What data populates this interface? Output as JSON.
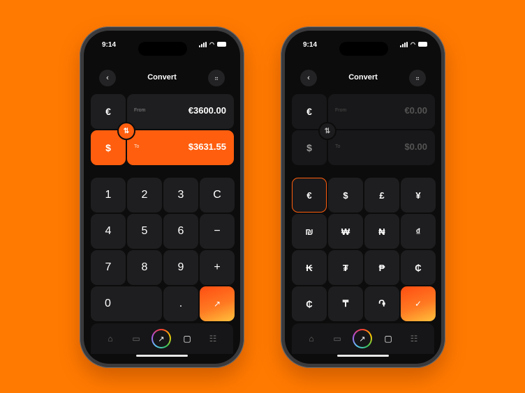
{
  "left_phone": {
    "status": {
      "time": "9:14"
    },
    "nav": {
      "back_icon": "chevron-left-icon",
      "title": "Convert",
      "menu_icon": "grid-dots-icon"
    },
    "from": {
      "currency": "€",
      "label": "From",
      "amount": "€3600.00"
    },
    "to": {
      "currency": "$",
      "label": "To",
      "amount": "$3631.55"
    },
    "swap_icon": "swap-vertical-icon",
    "keypad": [
      "1",
      "2",
      "3",
      "C",
      "4",
      "5",
      "6",
      "−",
      "7",
      "8",
      "9",
      "+",
      "0",
      "."
    ],
    "go_icon": "arrow-up-right-icon"
  },
  "right_phone": {
    "status": {
      "time": "9:14"
    },
    "nav": {
      "back_icon": "chevron-left-icon",
      "title": "Convert",
      "menu_icon": "grid-dots-icon"
    },
    "from": {
      "currency": "€",
      "label": "From",
      "amount": "€0.00"
    },
    "to": {
      "currency": "$",
      "label": "To",
      "amount": "$0.00"
    },
    "swap_icon": "swap-vertical-icon",
    "currencies": [
      "€",
      "$",
      "£",
      "¥",
      "₪",
      "₩",
      "₦",
      "₫",
      "₭",
      "₮",
      "₱",
      "₵",
      "₵",
      "₸",
      "֏"
    ],
    "selected_currency": "€",
    "confirm_icon": "check-icon"
  },
  "tabbar": {
    "items": [
      "home-icon",
      "card-icon",
      "arrow-up-right-icon",
      "square-icon",
      "sliders-icon"
    ]
  },
  "colors": {
    "background": "#ff7a00",
    "accent": "#ff5e0e",
    "screen": "#0c0c0c",
    "key": "#1e1e20"
  }
}
